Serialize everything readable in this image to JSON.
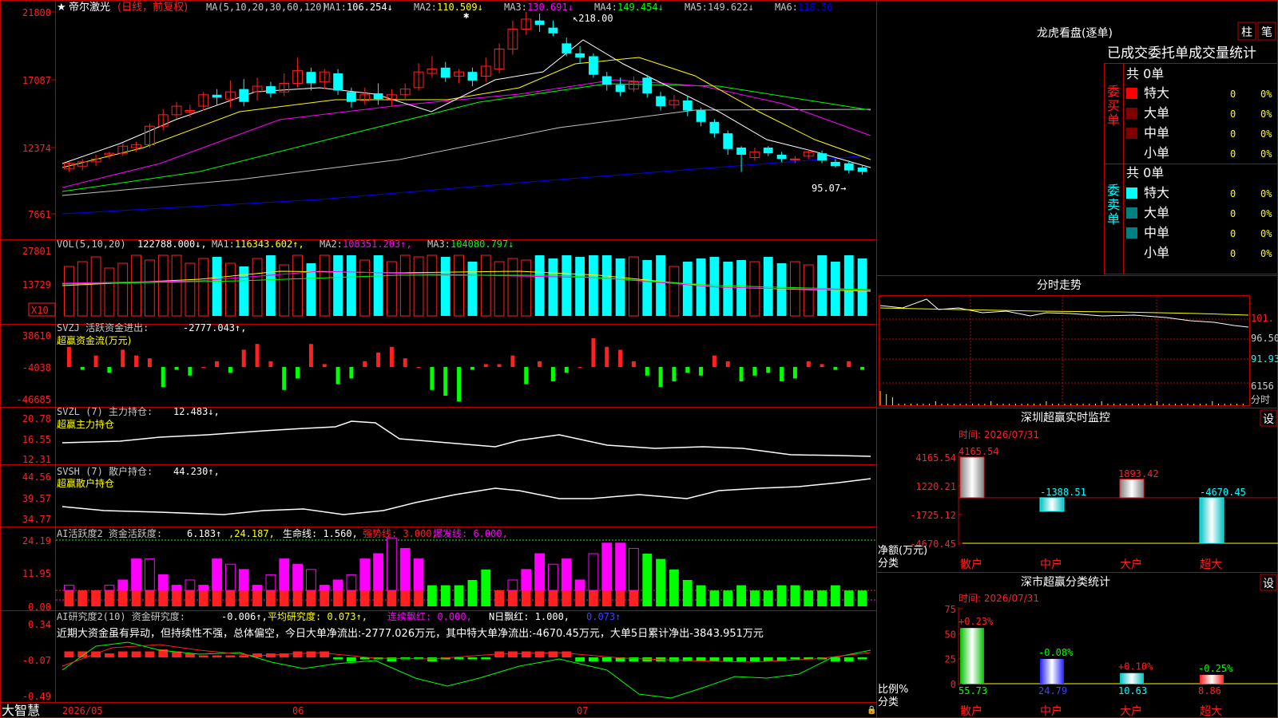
{
  "app": {
    "brand": "大智慧",
    "stock_name": "帝尔激光",
    "mode": "(日线，前复权)"
  },
  "colors": {
    "up": "#ff2020",
    "down": "#00ffff",
    "ma1": "#ffffff",
    "ma2": "#ffff00",
    "ma3": "#ff00ff",
    "ma4": "#00ff00",
    "ma5": "#c0c0c0",
    "ma6": "#0000ff",
    "bg": "#000000",
    "border": "#c00000"
  },
  "price_panel": {
    "header_ma": "MA(5,10,20,30,60,120)",
    "ma_values": [
      {
        "label": "MA1:",
        "value": "106.254↓",
        "color": "#ffffff"
      },
      {
        "label": "MA2:",
        "value": "110.509↓",
        "color": "#ffff00"
      },
      {
        "label": "MA3:",
        "value": "130.691↓",
        "color": "#ff00ff"
      },
      {
        "label": "MA4:",
        "value": "149.454↓",
        "color": "#00ff00"
      },
      {
        "label": "MA5:",
        "value": "149.622↓",
        "color": "#c0c0c0"
      },
      {
        "label": "MA6:",
        "value": "118.56",
        "color": "#0000ff"
      }
    ],
    "y_ticks": [
      "21800",
      "17087",
      "12374",
      "7661"
    ],
    "high_marker": "218.00",
    "low_marker": "95.07"
  },
  "volume_panel": {
    "header": "VOL(5,10,20)",
    "value": "122788.000↓,",
    "ma_values": [
      {
        "label": "MA1:",
        "value": "116343.602↑,",
        "color": "#ffff00"
      },
      {
        "label": "MA2:",
        "value": "108351.203↑,",
        "color": "#ff00ff"
      },
      {
        "label": "MA3:",
        "value": "104080.797↓",
        "color": "#00ff00"
      }
    ],
    "y_ticks": [
      "27801",
      "13729"
    ],
    "unit": "X10"
  },
  "svzj_panel": {
    "header": "SVZJ  活跃资金进出:",
    "value": "-2777.043↑,",
    "subtitle": "超赢资金流(万元)",
    "y_ticks": [
      "38610",
      "-4038",
      "-46685"
    ]
  },
  "svzl_panel": {
    "header": "SVZL (7) 主力持仓:",
    "value": "12.483↓,",
    "subtitle": "超赢主力持仓",
    "y_ticks": [
      "20.78",
      "16.55",
      "12.31"
    ]
  },
  "svsh_panel": {
    "header": "SVSH (7) 散户持仓:",
    "value": "44.230↑,",
    "subtitle": "超赢散户持仓",
    "y_ticks": [
      "44.56",
      "39.57",
      "34.77"
    ]
  },
  "ai_active_panel": {
    "header": "AI活跃度2 资金活跃度:",
    "items": [
      {
        "text": "6.183↑",
        "color": "#ffffff"
      },
      {
        "text": ",24.187,",
        "color": "#ffff00"
      },
      {
        "text": "生命线: 1.560,",
        "color": "#ffffff"
      },
      {
        "text": "强势线: 3.000,",
        "color": "#ff2020"
      },
      {
        "text": "爆发线: 6.000,",
        "color": "#ff00ff"
      }
    ],
    "y_ticks": [
      "24.19",
      "11.95",
      "0.00"
    ]
  },
  "ai_research_panel": {
    "header": "AI研究度2(10) 资金研究度:",
    "items": [
      {
        "text": "-0.006↑,",
        "color": "#ffffff"
      },
      {
        "text": "平均研究度: 0.073↑,",
        "color": "#ffff00"
      },
      {
        "text": "连续飘红: 0.000,",
        "color": "#ff00ff"
      },
      {
        "text": "N日飘红: 1.000,",
        "color": "#ffffff"
      },
      {
        "text": "0.073↑",
        "color": "#4040ff"
      }
    ],
    "comment": "近期大资金虽有异动，但持续性不强，总体偏空，今日大单净流出:-2777.026万元，其中特大单净流出:-4670.45万元，大单5日累计净出-3843.951万元",
    "y_ticks": [
      "0.34",
      "-0.07",
      "-0.49"
    ]
  },
  "x_axis": {
    "labels": [
      "2026/05",
      "06",
      "07"
    ]
  },
  "right_panel": {
    "title": "龙虎看盘(逐单)",
    "btn_zhu": "柱",
    "btn_bi": "笔",
    "table_title": "已成交委托单成交量统计",
    "buy_label": "委买单",
    "sell_label": "委卖单",
    "buy_total": "共 0单",
    "sell_total": "共 0单",
    "buy_rows": [
      {
        "name": "特大",
        "vol": "0",
        "pct": "0%",
        "color": "#ff0000"
      },
      {
        "name": "大单",
        "vol": "0",
        "pct": "0%",
        "color": "#800000"
      },
      {
        "name": "中单",
        "vol": "0",
        "pct": "0%",
        "color": "#800000"
      },
      {
        "name": "小单",
        "vol": "0",
        "pct": "0%",
        "color": ""
      }
    ],
    "sell_rows": [
      {
        "name": "特大",
        "vol": "0",
        "pct": "0%",
        "color": "#00ffff"
      },
      {
        "name": "大单",
        "vol": "0",
        "pct": "0%",
        "color": "#008080"
      },
      {
        "name": "中单",
        "vol": "0",
        "pct": "0%",
        "color": "#008080"
      },
      {
        "name": "小单",
        "vol": "0",
        "pct": "0%",
        "color": ""
      }
    ],
    "intraday_title": "分时走势",
    "intraday_ticks": [
      "101.",
      "96.50",
      "91.93",
      "6156"
    ],
    "intraday_unit": "分时",
    "monitor_title": "深圳超赢实时监控",
    "monitor_btn": "设",
    "monitor_time": "时间: 2026/07/31",
    "monitor_ylabel": "净额(万元)",
    "monitor_xlabel": "分类",
    "stats_title": "深市超赢分类统计",
    "stats_btn": "设",
    "stats_time": "时间: 2026/07/31",
    "stats_ylabel": "比例%",
    "stats_xlabel": "分类"
  },
  "chart_data": [
    {
      "type": "bar",
      "title": "深圳超赢实时监控",
      "ylabel": "净额(万元)",
      "categories": [
        "散户",
        "中户",
        "大户",
        "超大"
      ],
      "values": [
        4165.54,
        -1388.51,
        1893.42,
        -4670.45
      ],
      "y_ticks": [
        4165.54,
        1220.21,
        -1725.12,
        -4670.45
      ],
      "ylim": [
        -4670.45,
        4165.54
      ]
    },
    {
      "type": "bar",
      "title": "深市超赢分类统计",
      "ylabel": "比例%",
      "categories": [
        "散户",
        "中户",
        "大户",
        "超大"
      ],
      "values": [
        55.73,
        24.79,
        10.63,
        8.86
      ],
      "changes": [
        "+0.23%",
        "-0.08%",
        "+0.10%",
        "-0.25%"
      ],
      "y_ticks": [
        75,
        50,
        25,
        0
      ],
      "ylim": [
        0,
        75
      ]
    }
  ]
}
